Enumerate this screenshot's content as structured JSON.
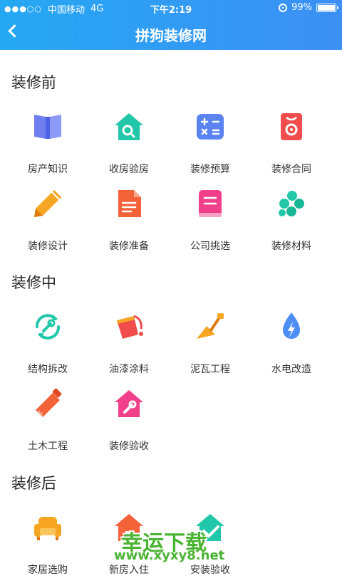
{
  "status_bar": {
    "carrier": "中国移动",
    "network": "4G",
    "time": "下午2:19",
    "battery": "99%",
    "battery_level": 0.99
  },
  "header": {
    "title": "拼狗装修网"
  },
  "sections": [
    {
      "title": "装修前",
      "items": [
        {
          "label": "房产知识",
          "icon": "book-icon"
        },
        {
          "label": "收房验房",
          "icon": "house-search-icon"
        },
        {
          "label": "装修预算",
          "icon": "calculator-icon"
        },
        {
          "label": "装修合同",
          "icon": "contract-icon"
        },
        {
          "label": "装修设计",
          "icon": "pencil-icon"
        },
        {
          "label": "装修准备",
          "icon": "document-icon"
        },
        {
          "label": "公司挑选",
          "icon": "list-book-icon"
        },
        {
          "label": "装修材料",
          "icon": "materials-icon"
        }
      ]
    },
    {
      "title": "装修中",
      "items": [
        {
          "label": "结构拆改",
          "icon": "wrench-cycle-icon"
        },
        {
          "label": "油漆涂料",
          "icon": "paint-bucket-icon"
        },
        {
          "label": "泥瓦工程",
          "icon": "trowel-icon"
        },
        {
          "label": "水电改造",
          "icon": "water-electric-icon"
        },
        {
          "label": "土木工程",
          "icon": "saw-icon"
        },
        {
          "label": "装修验收",
          "icon": "house-tool-icon"
        }
      ]
    },
    {
      "title": "装修后",
      "items": [
        {
          "label": "家居选购",
          "icon": "sofa-icon"
        },
        {
          "label": "新房入住",
          "icon": "house-icon"
        },
        {
          "label": "安装验收",
          "icon": "check-house-icon"
        }
      ]
    }
  ],
  "watermark": {
    "main": "幸运下载",
    "sub": "www.xyxy8.net"
  },
  "colors": {
    "header_start": "#25a8f3",
    "header_end": "#3c8ff4",
    "watermark": "#4ab332"
  }
}
